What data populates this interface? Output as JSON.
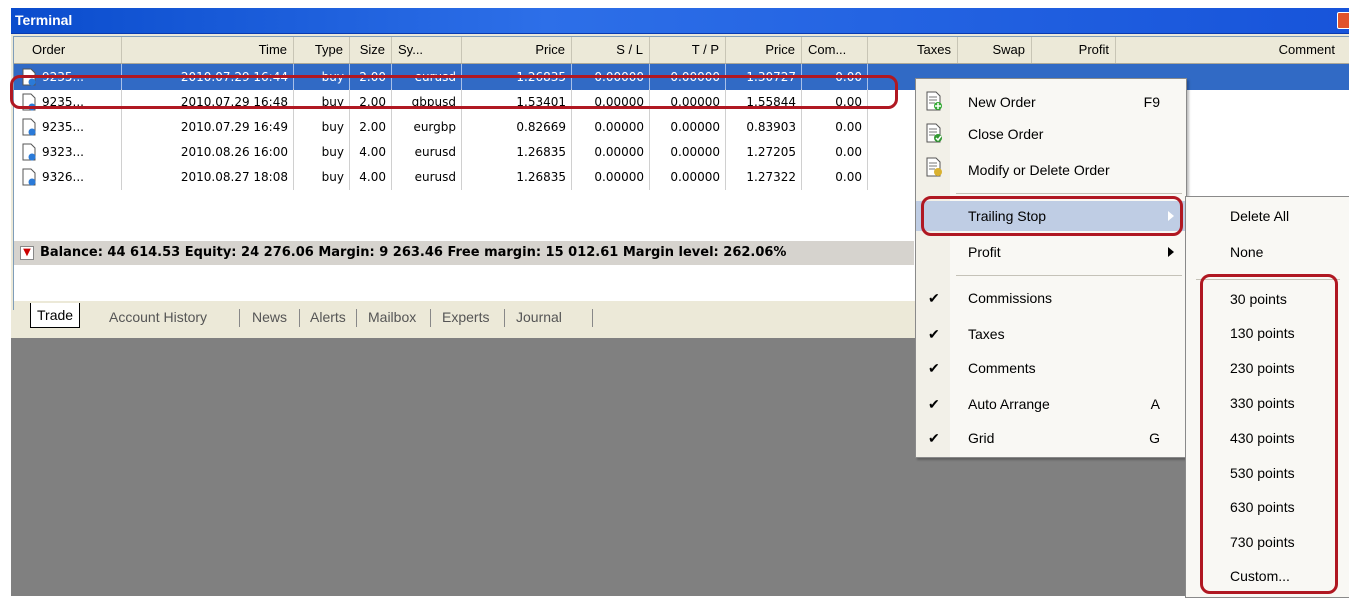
{
  "window": {
    "title": "Terminal"
  },
  "columns": [
    "Order",
    "Time",
    "Type",
    "Size",
    "Sy...",
    "Price",
    "S / L",
    "T / P",
    "Price",
    "Com...",
    "Taxes",
    "Swap",
    "Profit",
    "Comment"
  ],
  "rows": [
    {
      "order": "9235...",
      "time": "2010.07.29 16:44",
      "type": "buy",
      "size": "2.00",
      "symbol": "eurusd",
      "price": "1.26835",
      "sl": "0.00000",
      "tp": "0.00000",
      "cur_price": "1.30727",
      "commission": "0.00"
    },
    {
      "order": "9235...",
      "time": "2010.07.29 16:48",
      "type": "buy",
      "size": "2.00",
      "symbol": "gbpusd",
      "price": "1.53401",
      "sl": "0.00000",
      "tp": "0.00000",
      "cur_price": "1.55844",
      "commission": "0.00"
    },
    {
      "order": "9235...",
      "time": "2010.07.29 16:49",
      "type": "buy",
      "size": "2.00",
      "symbol": "eurgbp",
      "price": "0.82669",
      "sl": "0.00000",
      "tp": "0.00000",
      "cur_price": "0.83903",
      "commission": "0.00"
    },
    {
      "order": "9323...",
      "time": "2010.08.26 16:00",
      "type": "buy",
      "size": "4.00",
      "symbol": "eurusd",
      "price": "1.26835",
      "sl": "0.00000",
      "tp": "0.00000",
      "cur_price": "1.27205",
      "commission": "0.00"
    },
    {
      "order": "9326...",
      "time": "2010.08.27 18:08",
      "type": "buy",
      "size": "4.00",
      "symbol": "eurusd",
      "price": "1.26835",
      "sl": "0.00000",
      "tp": "0.00000",
      "cur_price": "1.27322",
      "commission": "0.00"
    }
  ],
  "balance_line": "Balance: 44 614.53  Equity: 24 276.06  Margin: 9 263.46  Free margin: 15 012.61  Margin level: 262.06%",
  "tabs": [
    "Trade",
    "Account History",
    "News",
    "Alerts",
    "Mailbox",
    "Experts",
    "Journal"
  ],
  "context_menu": {
    "new_order": {
      "label": "New Order",
      "shortcut": "F9"
    },
    "close_order": {
      "label": "Close Order"
    },
    "modify_order": {
      "label": "Modify or Delete Order"
    },
    "trailing_stop": {
      "label": "Trailing Stop"
    },
    "profit": {
      "label": "Profit"
    },
    "commissions": {
      "label": "Commissions",
      "checked": true
    },
    "taxes": {
      "label": "Taxes",
      "checked": true
    },
    "comments": {
      "label": "Comments",
      "checked": true
    },
    "auto_arrange": {
      "label": "Auto Arrange",
      "shortcut": "A",
      "checked": true
    },
    "grid": {
      "label": "Grid",
      "shortcut": "G",
      "checked": true
    }
  },
  "trailing_submenu": [
    "Delete All",
    "None",
    "30 points",
    "130 points",
    "230 points",
    "330 points",
    "430 points",
    "530 points",
    "630 points",
    "730 points",
    "Custom..."
  ],
  "colors": {
    "selection": "#316ac5",
    "highlight_box": "#b01822",
    "menu_highlight": "#bfcde4"
  }
}
